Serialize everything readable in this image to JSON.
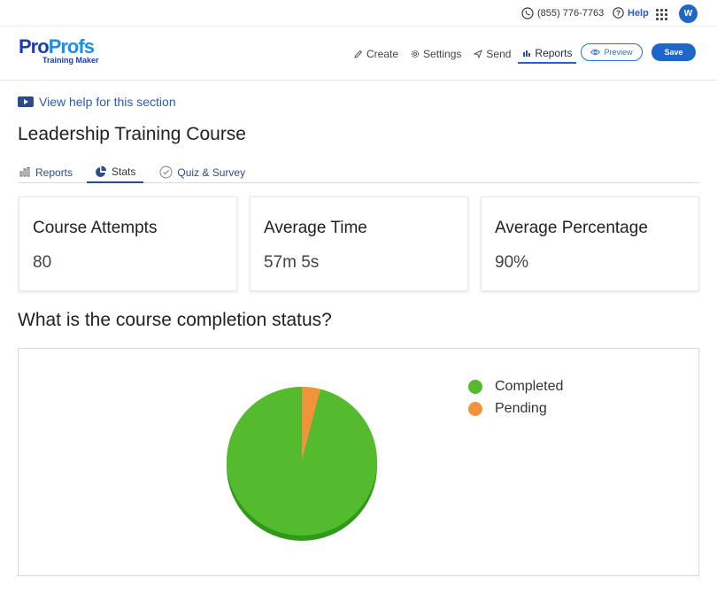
{
  "topbar": {
    "phone": "(855) 776-7763",
    "help_label": "Help",
    "avatar_initial": "W"
  },
  "brand": {
    "logo_pro": "Pro",
    "logo_profs": "Profs",
    "logo_sub": "Training Maker"
  },
  "nav": {
    "items": [
      {
        "label": "Create",
        "icon": "pencil-icon"
      },
      {
        "label": "Settings",
        "icon": "gear-icon"
      },
      {
        "label": "Send",
        "icon": "send-icon"
      },
      {
        "label": "Reports",
        "icon": "bar-chart-icon",
        "active": true
      }
    ],
    "preview_label": "Preview",
    "save_label": "Save"
  },
  "page": {
    "help_link": "View help for this section",
    "title": "Leadership Training Course"
  },
  "tabs": [
    {
      "label": "Reports",
      "icon": "bar-chart-icon"
    },
    {
      "label": "Stats",
      "icon": "pie-chart-icon",
      "active": true
    },
    {
      "label": "Quiz & Survey",
      "icon": "check-circle-icon"
    }
  ],
  "stats": [
    {
      "label": "Course Attempts",
      "value": "80"
    },
    {
      "label": "Average Time",
      "value": "57m 5s"
    },
    {
      "label": "Average Percentage",
      "value": "90%"
    }
  ],
  "completion_section_title": "What is the course completion status?",
  "colors": {
    "accent": "#1f66c9",
    "completed": "#55bb2e",
    "completed_shadow": "#2f9a17",
    "pending": "#f0933a"
  },
  "chart_data": {
    "type": "pie",
    "categories": [
      "Completed",
      "Pending"
    ],
    "values": [
      96,
      4
    ],
    "colors": [
      "#55bb2e",
      "#f0933a"
    ],
    "legend": "top-right"
  }
}
